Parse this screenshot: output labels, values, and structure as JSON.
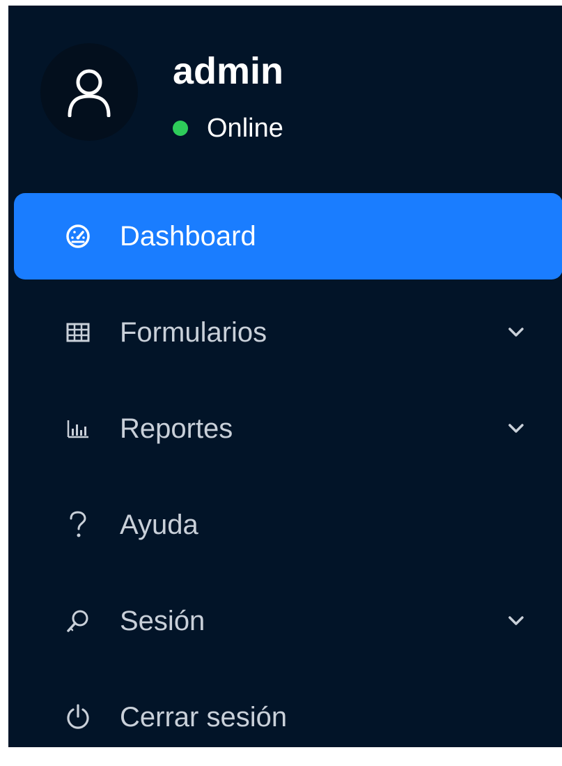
{
  "user": {
    "name": "admin",
    "status": "Online",
    "status_color": "#2ecc5a",
    "avatar_icon": "user-icon"
  },
  "colors": {
    "sidebar_bg": "#021428",
    "active_bg": "#1a7dff",
    "text_active": "#ffffff",
    "text_inactive": "#c9d0d9"
  },
  "nav": {
    "items": [
      {
        "label": "Dashboard",
        "icon": "dashboard-gauge-icon",
        "active": true,
        "has_submenu": false
      },
      {
        "label": "Formularios",
        "icon": "table-grid-icon",
        "active": false,
        "has_submenu": true
      },
      {
        "label": "Reportes",
        "icon": "bar-chart-icon",
        "active": false,
        "has_submenu": true
      },
      {
        "label": "Ayuda",
        "icon": "question-mark-icon",
        "active": false,
        "has_submenu": false
      },
      {
        "label": "Sesión",
        "icon": "key-search-icon",
        "active": false,
        "has_submenu": true
      },
      {
        "label": "Cerrar sesión",
        "icon": "power-icon",
        "active": false,
        "has_submenu": false
      }
    ]
  }
}
